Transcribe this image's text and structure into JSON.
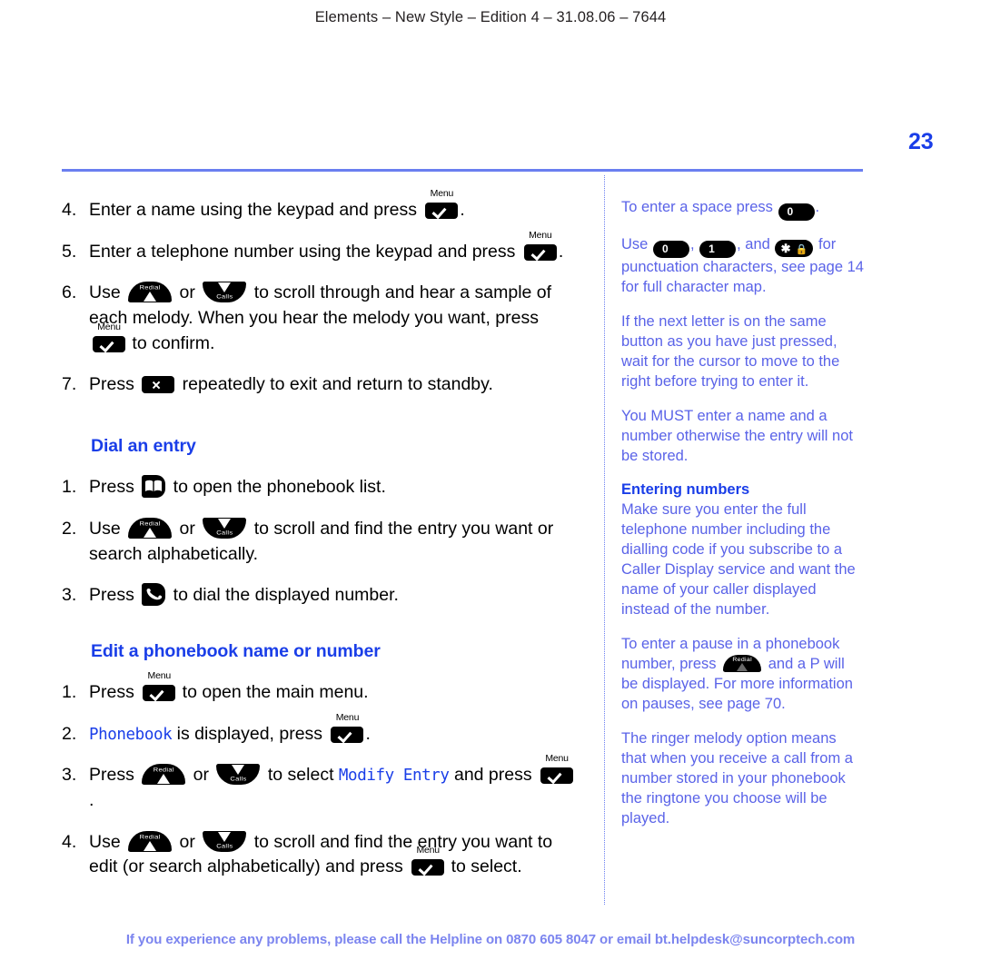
{
  "header": {
    "running_head": "Elements – New Style – Edition 4 – 31.08.06 – 7644"
  },
  "folio": {
    "page_number": "23"
  },
  "colors": {
    "accent_blue": "#1a3ee8",
    "rule_blue": "#6a7ef0",
    "sidebar_text": "#5a63e8",
    "footer_text": "#7c85ef",
    "body_text": "#000000"
  },
  "main": {
    "steps_continued": [
      {
        "num": "4.",
        "parts": [
          {
            "t": "text",
            "v": "Enter a name using the keypad and press "
          },
          {
            "t": "icon",
            "icon": "menu-key",
            "label": "Menu"
          },
          {
            "t": "text",
            "v": "."
          }
        ]
      },
      {
        "num": "5.",
        "parts": [
          {
            "t": "text",
            "v": "Enter a telephone number using the keypad and press "
          },
          {
            "t": "icon",
            "icon": "menu-key",
            "label": "Menu"
          },
          {
            "t": "text",
            "v": "."
          }
        ]
      },
      {
        "num": "6.",
        "parts": [
          {
            "t": "text",
            "v": "Use "
          },
          {
            "t": "icon",
            "icon": "redial-key",
            "label": "Redial"
          },
          {
            "t": "text",
            "v": " or "
          },
          {
            "t": "icon",
            "icon": "calls-key",
            "label": "Calls"
          },
          {
            "t": "text",
            "v": " to scroll through and hear a sample of each melody. When you hear the melody you want, press "
          },
          {
            "t": "icon",
            "icon": "menu-key",
            "label": "Menu"
          },
          {
            "t": "text",
            "v": " to confirm."
          }
        ]
      },
      {
        "num": "7.",
        "parts": [
          {
            "t": "text",
            "v": "Press "
          },
          {
            "t": "icon",
            "icon": "cancel-key",
            "label": ""
          },
          {
            "t": "text",
            "v": " repeatedly to exit and return to standby."
          }
        ]
      }
    ],
    "section_dial": {
      "heading": "Dial an entry",
      "steps": [
        {
          "num": "1.",
          "parts": [
            {
              "t": "text",
              "v": "Press "
            },
            {
              "t": "icon",
              "icon": "phonebook-key",
              "label": ""
            },
            {
              "t": "text",
              "v": " to open the phonebook list."
            }
          ]
        },
        {
          "num": "2.",
          "parts": [
            {
              "t": "text",
              "v": "Use "
            },
            {
              "t": "icon",
              "icon": "redial-key",
              "label": "Redial"
            },
            {
              "t": "text",
              "v": " or "
            },
            {
              "t": "icon",
              "icon": "calls-key",
              "label": "Calls"
            },
            {
              "t": "text",
              "v": " to scroll and find the entry you want or search alphabetically."
            }
          ]
        },
        {
          "num": "3.",
          "parts": [
            {
              "t": "text",
              "v": "Press "
            },
            {
              "t": "icon",
              "icon": "dial-key",
              "label": ""
            },
            {
              "t": "text",
              "v": " to dial the displayed number."
            }
          ]
        }
      ]
    },
    "section_edit": {
      "heading": "Edit a phonebook name or number",
      "steps": [
        {
          "num": "1.",
          "parts": [
            {
              "t": "text",
              "v": "Press "
            },
            {
              "t": "icon",
              "icon": "menu-key",
              "label": "Menu"
            },
            {
              "t": "text",
              "v": " to open the main menu."
            }
          ]
        },
        {
          "num": "2.",
          "parts": [
            {
              "t": "lcd",
              "v": "Phonebook"
            },
            {
              "t": "text",
              "v": " is displayed, press "
            },
            {
              "t": "icon",
              "icon": "menu-key",
              "label": "Menu"
            },
            {
              "t": "text",
              "v": "."
            }
          ]
        },
        {
          "num": "3.",
          "parts": [
            {
              "t": "text",
              "v": "Press "
            },
            {
              "t": "icon",
              "icon": "redial-key",
              "label": "Redial"
            },
            {
              "t": "text",
              "v": " or "
            },
            {
              "t": "icon",
              "icon": "calls-key",
              "label": "Calls"
            },
            {
              "t": "text",
              "v": " to select "
            },
            {
              "t": "lcd",
              "v": "Modify Entry"
            },
            {
              "t": "text",
              "v": " and press "
            },
            {
              "t": "icon",
              "icon": "menu-key",
              "label": "Menu"
            },
            {
              "t": "text",
              "v": "."
            }
          ]
        },
        {
          "num": "4.",
          "parts": [
            {
              "t": "text",
              "v": "Use "
            },
            {
              "t": "icon",
              "icon": "redial-key",
              "label": "Redial"
            },
            {
              "t": "text",
              "v": " or "
            },
            {
              "t": "icon",
              "icon": "calls-key",
              "label": "Calls"
            },
            {
              "t": "text",
              "v": " to scroll and find the entry you want to edit (or search alphabetically) and press "
            },
            {
              "t": "icon",
              "icon": "menu-key",
              "label": "Menu"
            },
            {
              "t": "text",
              "v": " to select."
            }
          ]
        }
      ]
    }
  },
  "sidebar": {
    "notes": [
      {
        "parts": [
          {
            "t": "text",
            "v": "To enter a space press "
          },
          {
            "t": "key",
            "key": "0"
          },
          {
            "t": "text",
            "v": "."
          }
        ]
      },
      {
        "parts": [
          {
            "t": "text",
            "v": "Use "
          },
          {
            "t": "key",
            "key": "0"
          },
          {
            "t": "text",
            "v": ", "
          },
          {
            "t": "key",
            "key": "1"
          },
          {
            "t": "text",
            "v": ", and "
          },
          {
            "t": "key",
            "key": "star-lock"
          },
          {
            "t": "text",
            "v": " for punctuation characters, see page 14 for full character map."
          }
        ]
      },
      {
        "parts": [
          {
            "t": "text",
            "v": "If the next letter is on the same button as you have just pressed, wait for the cursor to move to the right before trying to enter it."
          }
        ]
      },
      {
        "parts": [
          {
            "t": "text",
            "v": "You MUST enter a name and a number otherwise the entry will not be stored."
          }
        ]
      },
      {
        "heading": "Entering numbers",
        "parts": [
          {
            "t": "text",
            "v": "Make sure you enter the full telephone number including the dialling code if you subscribe to a Caller Display service and want the name of your caller displayed instead of the number."
          }
        ]
      },
      {
        "parts": [
          {
            "t": "text",
            "v": "To enter a pause in a phonebook number, press "
          },
          {
            "t": "icon",
            "icon": "redial-key-small",
            "label": "Redial"
          },
          {
            "t": "text",
            "v": " and a P will be displayed. For more information on pauses, see page 70."
          }
        ]
      },
      {
        "parts": [
          {
            "t": "text",
            "v": "The ringer melody option means that when you receive a call from a number stored in your phonebook the ringtone you choose will be played."
          }
        ]
      }
    ]
  },
  "footer": {
    "helpline": "If you experience any problems, please call the Helpline on 0870 605 8047 or email bt.helpdesk@suncorptech.com"
  },
  "keypad_labels": {
    "zero": "0",
    "one": "1",
    "star": "✱",
    "lock": "🔒"
  }
}
